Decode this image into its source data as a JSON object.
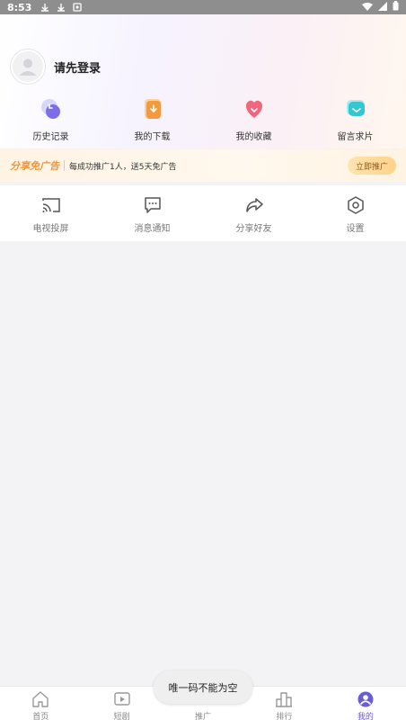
{
  "status_bar": {
    "time": "8:53"
  },
  "profile": {
    "login_prompt": "请先登录"
  },
  "quick_actions": [
    {
      "label": "历史记录",
      "icon": "history-icon",
      "color": "#7b6ee8"
    },
    {
      "label": "我的下载",
      "icon": "download-icon",
      "color": "#f59a3c"
    },
    {
      "label": "我的收藏",
      "icon": "favorite-icon",
      "color": "#f0677d"
    },
    {
      "label": "留言求片",
      "icon": "message-request-icon",
      "color": "#33c7d2"
    }
  ],
  "promo": {
    "title": "分享免广告",
    "description": "每成功推广1人，送5天免广告",
    "button": "立即推广"
  },
  "tools": [
    {
      "label": "电视投屏",
      "icon": "cast-icon"
    },
    {
      "label": "消息通知",
      "icon": "message-icon"
    },
    {
      "label": "分享好友",
      "icon": "share-icon"
    },
    {
      "label": "设置",
      "icon": "settings-icon"
    }
  ],
  "toast": {
    "text": "唯一码不能为空"
  },
  "tabbar": {
    "active_color": "#6a5cd6",
    "items": [
      {
        "label": "首页",
        "icon": "home-icon"
      },
      {
        "label": "短剧",
        "icon": "play-icon"
      },
      {
        "label": "推广",
        "icon": "promote-icon"
      },
      {
        "label": "排行",
        "icon": "ranking-icon"
      },
      {
        "label": "我的",
        "icon": "profile-icon"
      }
    ]
  }
}
